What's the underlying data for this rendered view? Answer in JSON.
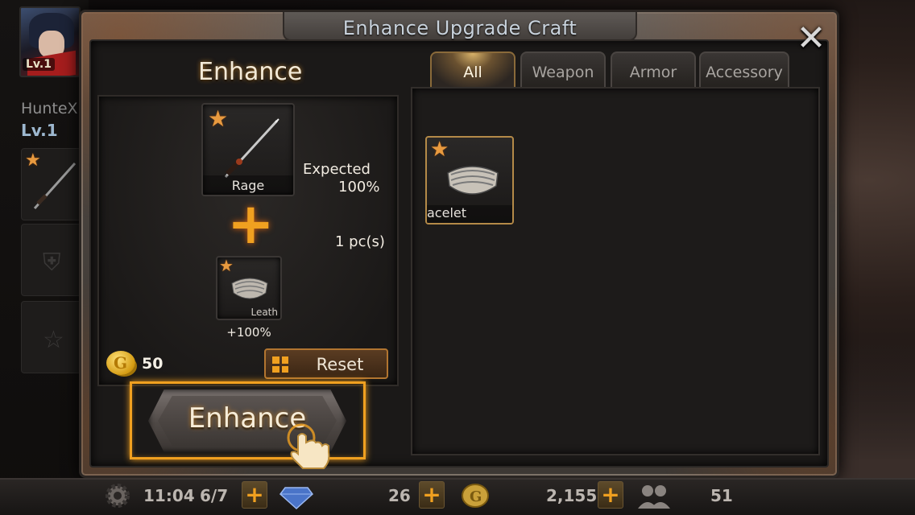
{
  "player": {
    "level_badge": "Lv.1",
    "name": "HunteX",
    "level": "Lv.1"
  },
  "dialog": {
    "title": "Enhance Upgrade Craft",
    "close_glyph": "✕"
  },
  "enhance": {
    "heading": "Enhance",
    "base_item": {
      "name": "Rage",
      "stars": "★",
      "icon": "katana-icon"
    },
    "plus_glyph": "+",
    "material_item": {
      "name": "Leath",
      "stars": "★",
      "icon": "bracelet-icon"
    },
    "material_bonus": "+100%",
    "expected_label": "Expected",
    "expected_value": "100%",
    "pieces": "1 pc(s)",
    "cost": "50",
    "reset_label": "Reset",
    "button_label": "Enhance"
  },
  "tabs": [
    {
      "label": "All",
      "active": true
    },
    {
      "label": "Weapon",
      "active": false
    },
    {
      "label": "Armor",
      "active": false
    },
    {
      "label": "Accessory",
      "active": false
    }
  ],
  "inventory": [
    {
      "name": "acelet",
      "stars": "★",
      "icon": "bracelet-icon"
    }
  ],
  "status_bar": {
    "time": "11:04",
    "stamina": "6/7",
    "gems": "26",
    "gold": "2,155",
    "friends": "51",
    "plus_glyph": "+"
  },
  "colors": {
    "accent": "#f0a020",
    "star": "#e89a3f",
    "title": "#c8d2dc"
  }
}
